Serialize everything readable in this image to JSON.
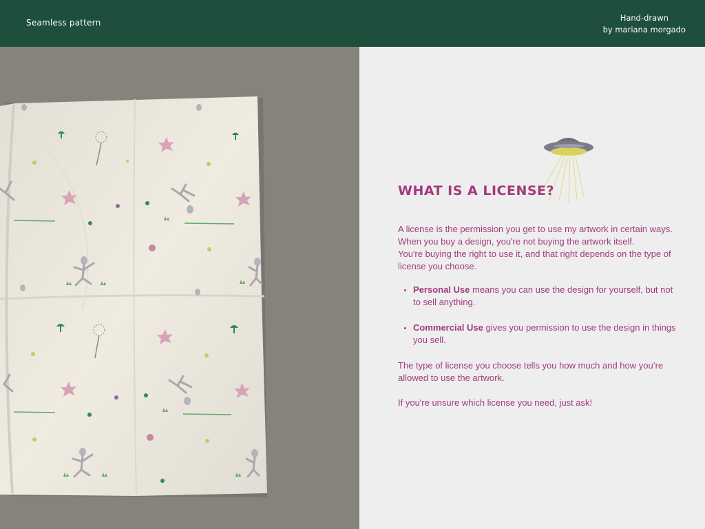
{
  "header": {
    "brand": "Seamless pattern",
    "credit_line1": "Hand-drawn",
    "credit_line2": "by mariana morgado"
  },
  "content": {
    "title": "What is a license?",
    "intro_1": " A license is the permission you get to use my artwork in certain ways.",
    "intro_2": "When you buy a design, you're not buying the artwork itself.",
    "intro_3": "You're buying the right to use it, and that right depends on the type of license you choose.",
    "licenses": [
      {
        "name": "Personal Use",
        "description": " means you can use the design for yourself, but not to sell anything."
      },
      {
        "name": "Commercial Use",
        "description": " gives you permission to use the design in things you sell."
      }
    ],
    "summary": "The type of license you choose tells you how much and how you’re allowed to use the artwork.",
    "closing": "If you're unsure which license you need, just ask!"
  },
  "colors": {
    "header_bg": "#1e4e3c",
    "accent_text": "#a23a7c",
    "panel_bg": "#eeeeee",
    "photo_bg": "#86837d",
    "fabric": "#efebe1"
  },
  "icons": {
    "ufo": "ufo-illustration",
    "pattern_motifs": [
      "alien",
      "dandelion",
      "mushroom",
      "pink-flower",
      "grass"
    ]
  }
}
